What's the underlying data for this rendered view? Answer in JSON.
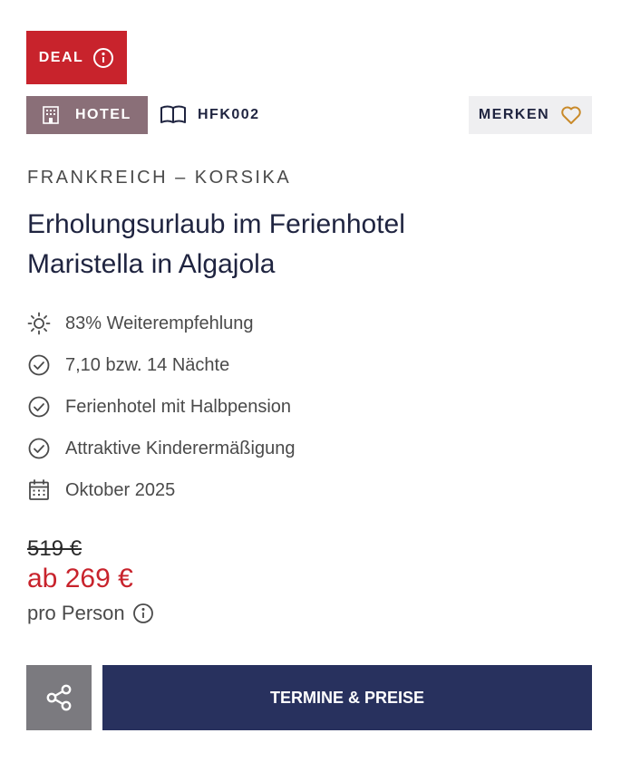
{
  "deal": {
    "label": "DEAL",
    "icon": "info-icon"
  },
  "tags": {
    "hotel": {
      "label": "HOTEL",
      "icon": "building-icon"
    },
    "code": {
      "label": "HFK002",
      "icon": "book-icon"
    }
  },
  "merken": {
    "label": "MERKEN",
    "icon": "heart-icon"
  },
  "region": "FRANKREICH – KORSIKA",
  "title_line1": "Erholungsurlaub im Ferienhotel",
  "title_line2": "Maristella in Algajola",
  "features": [
    {
      "icon": "sun-icon",
      "text": "83% Weiterempfehlung"
    },
    {
      "icon": "check-circle-icon",
      "text": "7,10 bzw. 14 Nächte"
    },
    {
      "icon": "check-circle-icon",
      "text": "Ferienhotel mit Halbpension"
    },
    {
      "icon": "check-circle-icon",
      "text": "Attraktive Kinderermäßigung"
    },
    {
      "icon": "calendar-icon",
      "text": "Oktober 2025"
    }
  ],
  "price": {
    "old": "519 €",
    "new": "ab 269 €",
    "per_person": "pro Person"
  },
  "actions": {
    "share_icon": "share-icon",
    "cta_label": "TERMINE & PREISE"
  },
  "colors": {
    "deal_red": "#c8232c",
    "hotel_tag": "#8a6f78",
    "navy": "#28315e",
    "share_gray": "#7b7a7f",
    "heart_orange": "#c98a2a"
  }
}
